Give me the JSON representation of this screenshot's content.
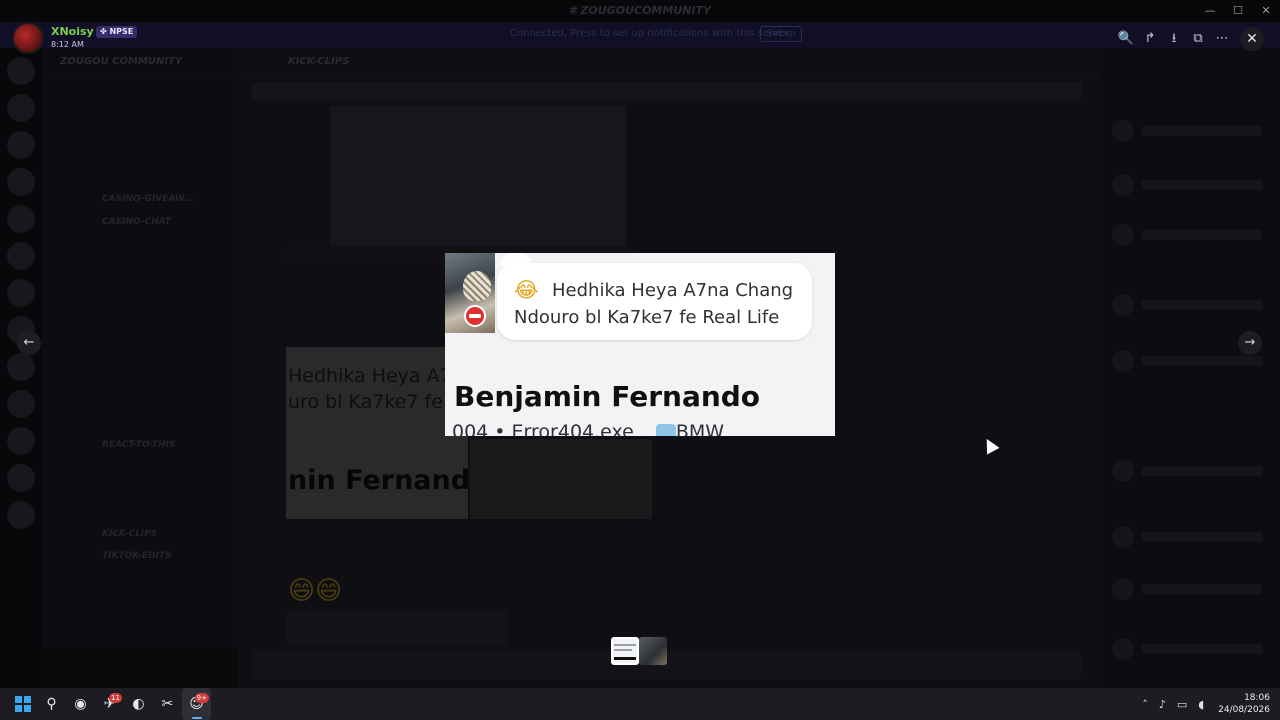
{
  "window": {
    "title": "# ZOUGOUCOMMUNITY",
    "controls": [
      "—",
      "☐",
      "✕"
    ]
  },
  "background": {
    "banner_text": "Connected, Press to set up notifications with this server",
    "banner_button": "Set up",
    "server_name": "ZOUGOU COMMUNITY",
    "channel_name": "KICK-CLIPS",
    "channels": [
      "",
      "",
      "",
      "",
      "",
      "CASINO-GIVEAW...",
      "CASINO-CHAT",
      "",
      "",
      "",
      "",
      "",
      "",
      "",
      "",
      "",
      "REACT-TO-THIS",
      "",
      "",
      "",
      "KICK-CLIPS",
      "TIKTOK-EDITS"
    ],
    "attachment_line1": "Hedhika Heya A7",
    "attachment_line2": "uro bl Ka7ke7 fe R",
    "attachment_name": "nin Fernando",
    "emoji": "😄😄"
  },
  "viewer": {
    "author": {
      "name": "XNoisy",
      "tag": "✤ NPSE",
      "time": "8:12 AM"
    },
    "actions": {
      "zoom_icon": "🔍",
      "forward_icon": "↱",
      "download_icon": "⭳",
      "open_icon": "⧉",
      "more_icon": "⋯",
      "close_icon": "✕"
    },
    "prev_icon": "←",
    "next_icon": "→",
    "image": {
      "emoji": "😂",
      "bubble_line1": "Hedhika Heya A7na Chang",
      "bubble_line2": "Ndouro bl Ka7ke7 fe Real Life",
      "name": "Benjamin Fernando",
      "sub": "004 • Error404.exe",
      "sub2": "BMW"
    }
  },
  "taskbar": {
    "badge_count": "11",
    "discord_badge": "9+",
    "time": "18:06",
    "date": "24/08/2026"
  },
  "colors": {
    "author_name": "#7bd14a",
    "tag_bg": "#3a2b6a",
    "block_badge": "#e02f2f",
    "windows_accent": "#3aa6f0"
  }
}
